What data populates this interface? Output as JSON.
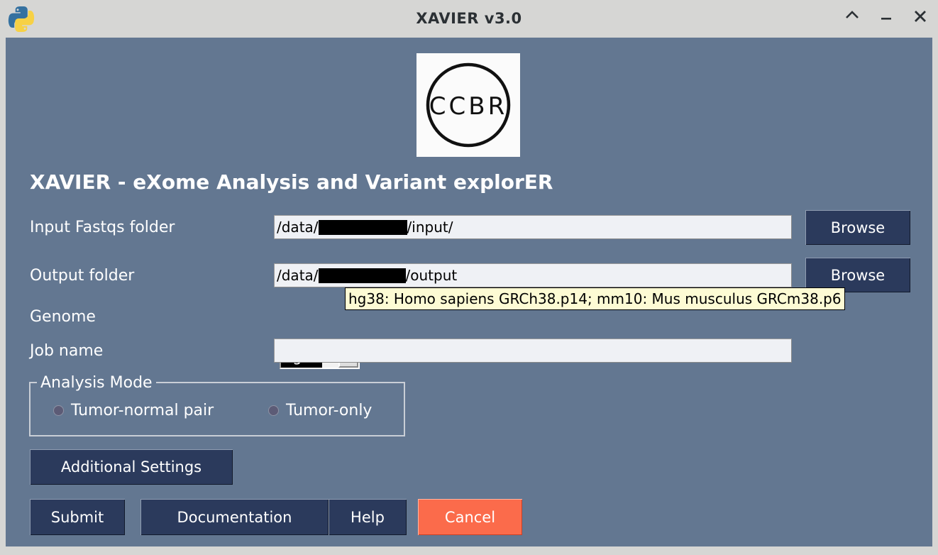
{
  "window": {
    "title": "XAVIER v3.0",
    "app_icon": "python-logo-icon",
    "controls": [
      {
        "name": "shade-button",
        "glyph": "chevron-up-icon"
      },
      {
        "name": "minimize-button",
        "glyph": "minimize-icon"
      },
      {
        "name": "close-button",
        "glyph": "close-icon"
      }
    ]
  },
  "logo": {
    "text": "CCBR",
    "alt": "ccbr-circle-logo"
  },
  "heading": "XAVIER - eXome Analysis and Variant explorER",
  "form": {
    "input_fastqs": {
      "label": "Input Fastqs folder",
      "value_prefix": "/data/",
      "value_suffix": "/input/",
      "redacted": true,
      "browse_label": "Browse"
    },
    "output_folder": {
      "label": "Output folder",
      "value_prefix": "/data/",
      "value_suffix": "/output",
      "redacted": true,
      "browse_label": "Browse"
    },
    "genome": {
      "label": "Genome",
      "selected": "hg38",
      "options": [
        "hg38",
        "mm10"
      ],
      "tooltip": "hg38: Homo sapiens GRCh38.p14; mm10: Mus musculus GRCm38.p6"
    },
    "job_name": {
      "label": "Job name",
      "value": "",
      "placeholder": ""
    },
    "analysis_mode": {
      "legend": "Analysis Mode",
      "options": [
        {
          "label": "Tumor-normal pair",
          "selected": false
        },
        {
          "label": "Tumor-only",
          "selected": false
        }
      ]
    }
  },
  "buttons": {
    "additional_settings": "Additional Settings",
    "submit": "Submit",
    "documentation": "Documentation",
    "help": "Help",
    "cancel": "Cancel"
  },
  "colors": {
    "window_chrome": "#d6d6d4",
    "client_background": "#637791",
    "button_navy": "#2b3a5c",
    "button_cancel": "#fb6b4b",
    "entry_background": "#eff1f5",
    "tooltip_background": "#fdfbd4",
    "text_white": "#ffffff"
  }
}
